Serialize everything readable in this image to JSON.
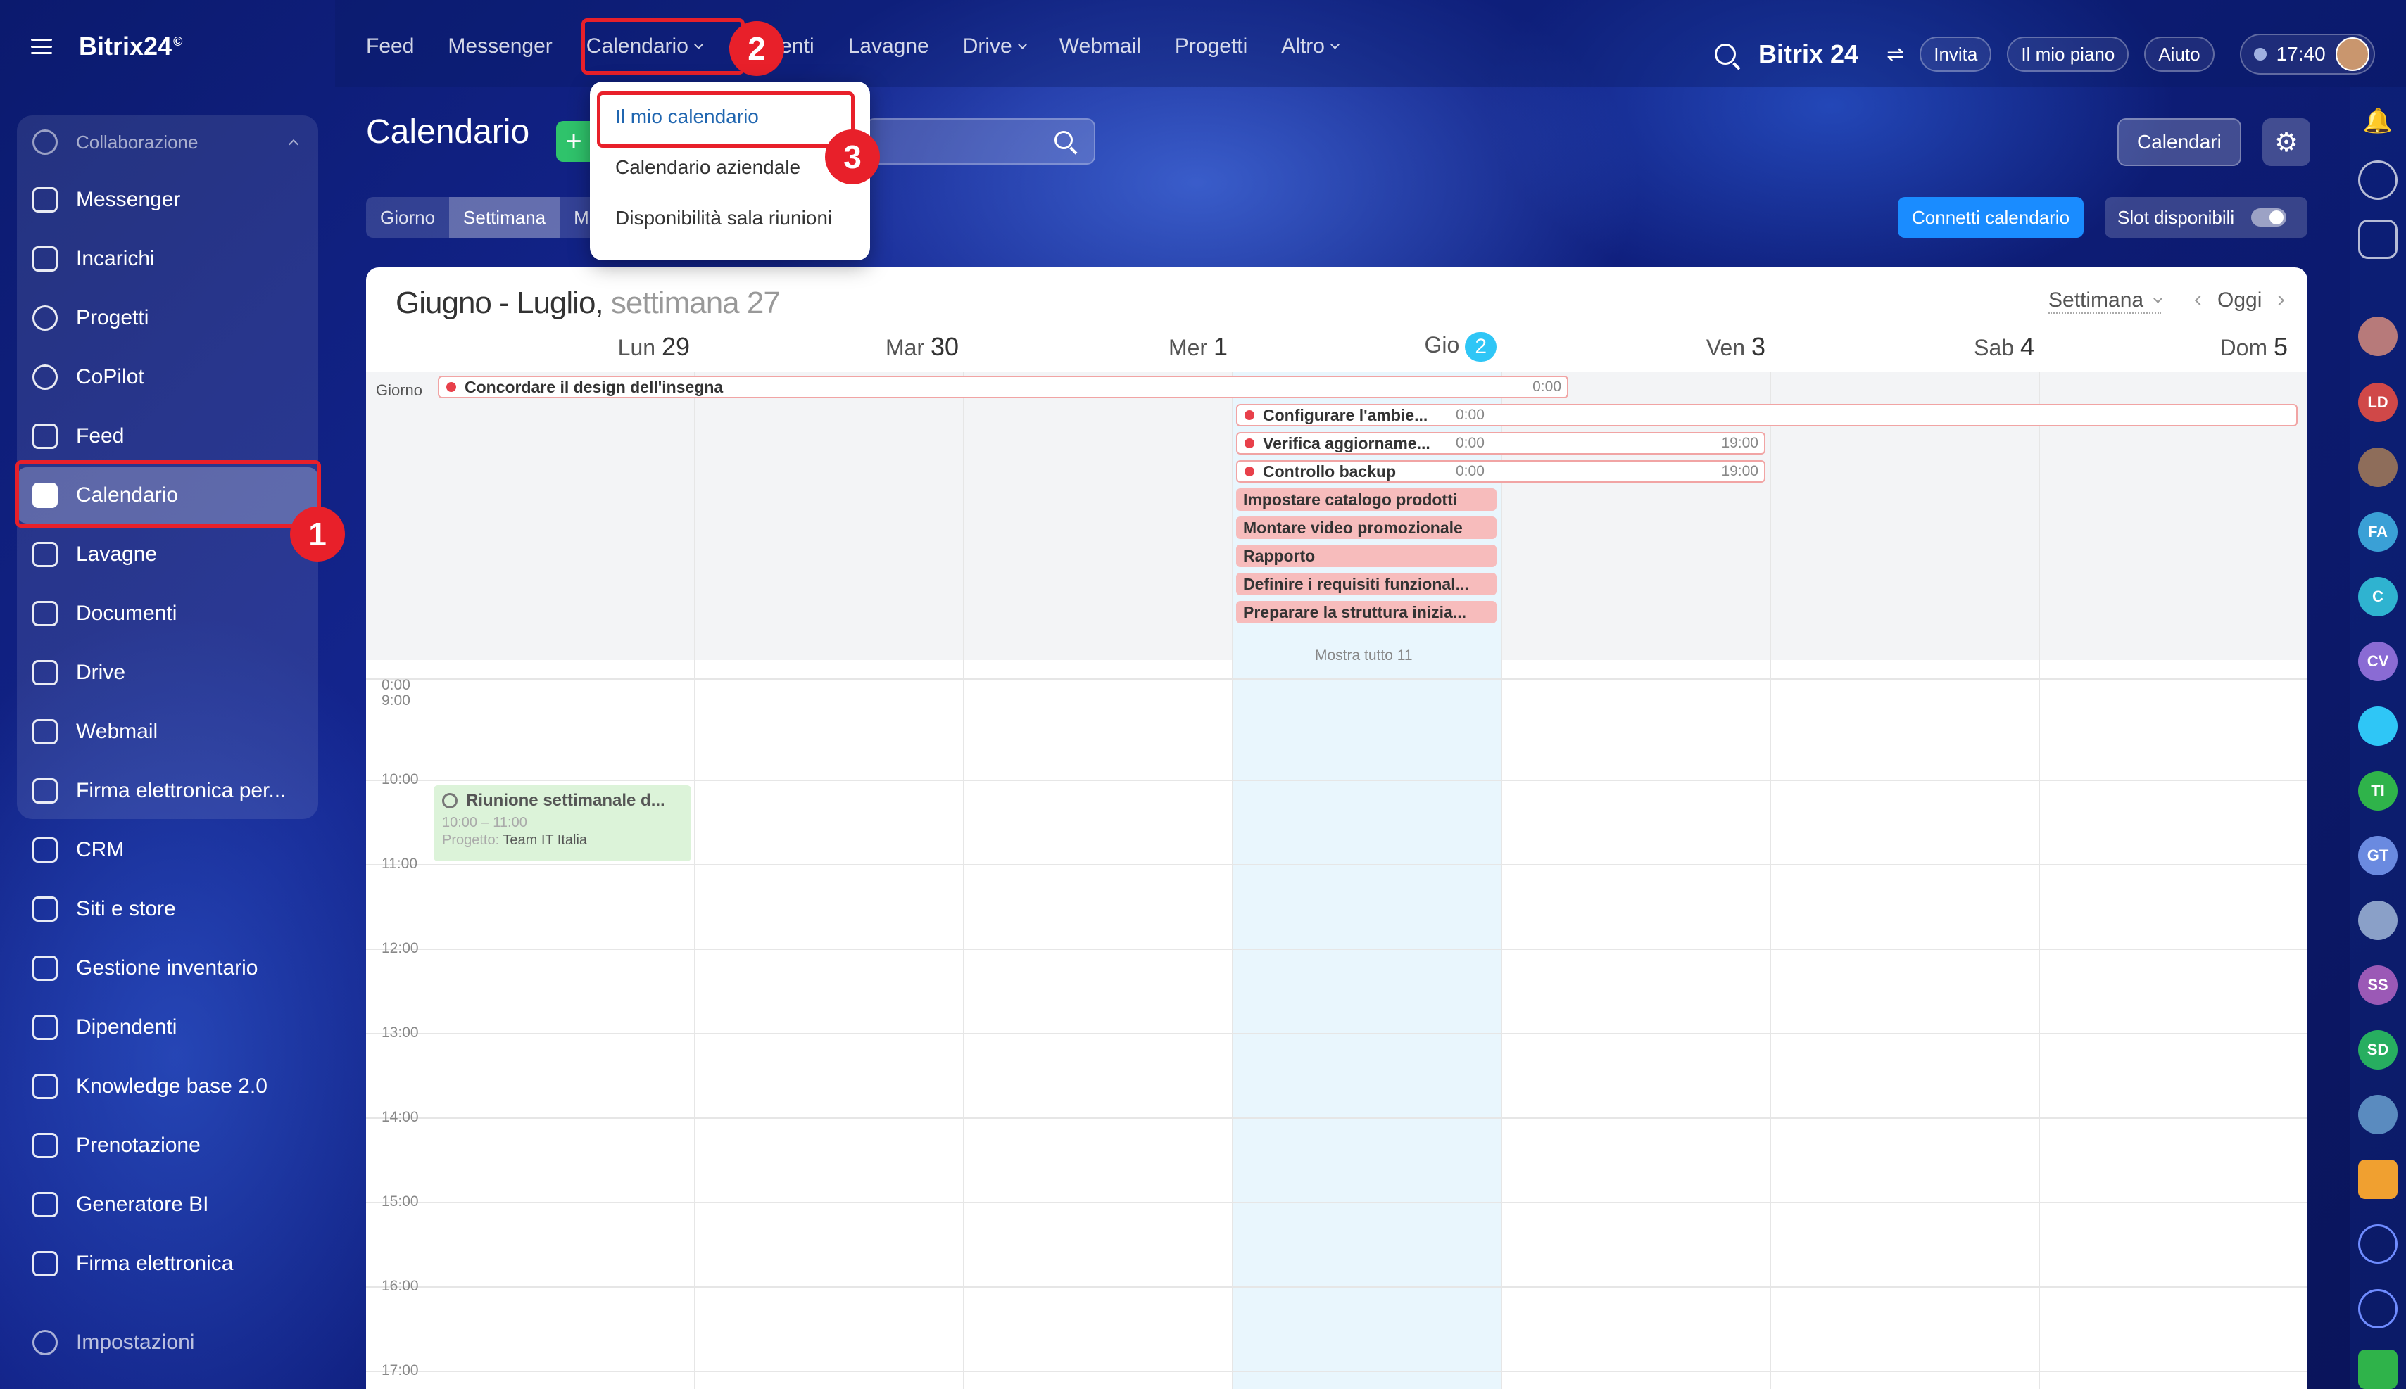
{
  "brand": {
    "name": "Bitrix24",
    "sup": "©"
  },
  "topnav": {
    "items": [
      "Feed",
      "Messenger",
      "Calendario",
      "ocumenti",
      "Lavagne",
      "Drive",
      "Webmail",
      "Progetti",
      "Altro"
    ],
    "right_brand": "Bitrix 24",
    "invite": "Invita",
    "plan": "Il mio piano",
    "help": "Aiuto",
    "time": "17:40"
  },
  "sidebar": {
    "group_title": "Collaborazione",
    "items": [
      "Messenger",
      "Incarichi",
      "Progetti",
      "CoPilot",
      "Feed",
      "Calendario",
      "Lavagne",
      "Documenti",
      "Drive",
      "Webmail",
      "Firma elettronica per...",
      "CRM",
      "Siti e store",
      "Gestione inventario",
      "Dipendenti",
      "Knowledge base 2.0",
      "Prenotazione",
      "Generatore BI",
      "Firma elettronica"
    ],
    "settings": "Impostazioni"
  },
  "calendar": {
    "title": "Calendario",
    "views": [
      "Giorno",
      "Settimana",
      "M"
    ],
    "calendars_btn": "Calendari",
    "connect_btn": "Connetti calendario",
    "slots_label": "Slot disponibili",
    "month_title": "Giugno - Luglio,",
    "week_label": "settimana 27",
    "view_select": "Settimana",
    "today": "Oggi",
    "allday_label": "Giorno",
    "days": [
      {
        "name": "Lun",
        "num": "29"
      },
      {
        "name": "Mar",
        "num": "30"
      },
      {
        "name": "Mer",
        "num": "1"
      },
      {
        "name": "Gio",
        "num": "2"
      },
      {
        "name": "Ven",
        "num": "3"
      },
      {
        "name": "Sab",
        "num": "4"
      },
      {
        "name": "Dom",
        "num": "5"
      }
    ],
    "allday_events": [
      {
        "title": "Concordare il design dell'insegna",
        "time": "0:00"
      },
      {
        "title": "Configurare l'ambie...",
        "time": "0:00"
      },
      {
        "title": "Verifica aggiorname...",
        "time": "0:00",
        "end": "19:00"
      },
      {
        "title": "Controllo backup",
        "time": "0:00",
        "end": "19:00"
      },
      {
        "title": "Impostare catalogo prodotti"
      },
      {
        "title": "Montare video promozionale"
      },
      {
        "title": "Rapporto"
      },
      {
        "title": "Definire i requisiti funzional..."
      },
      {
        "title": "Preparare la struttura inizia..."
      }
    ],
    "show_all": "Mostra tutto 11",
    "hours": [
      "0:00",
      "9:00",
      "10:00",
      "11:00",
      "12:00",
      "13:00",
      "14:00",
      "15:00",
      "16:00",
      "17:00"
    ],
    "meeting": {
      "title": "Riunione settimanale d...",
      "time": "10:00 – 11:00",
      "project_label": "Progetto:",
      "project": "Team IT Italia"
    }
  },
  "dropdown": {
    "items": [
      "Il mio calendario",
      "Calendario aziendale",
      "Disponibilità sala riunioni"
    ]
  },
  "annotations": [
    "1",
    "2",
    "3"
  ],
  "right_avatars": [
    "LD",
    "FA",
    "C",
    "CV",
    "TI",
    "GT",
    "SS",
    "SD"
  ]
}
